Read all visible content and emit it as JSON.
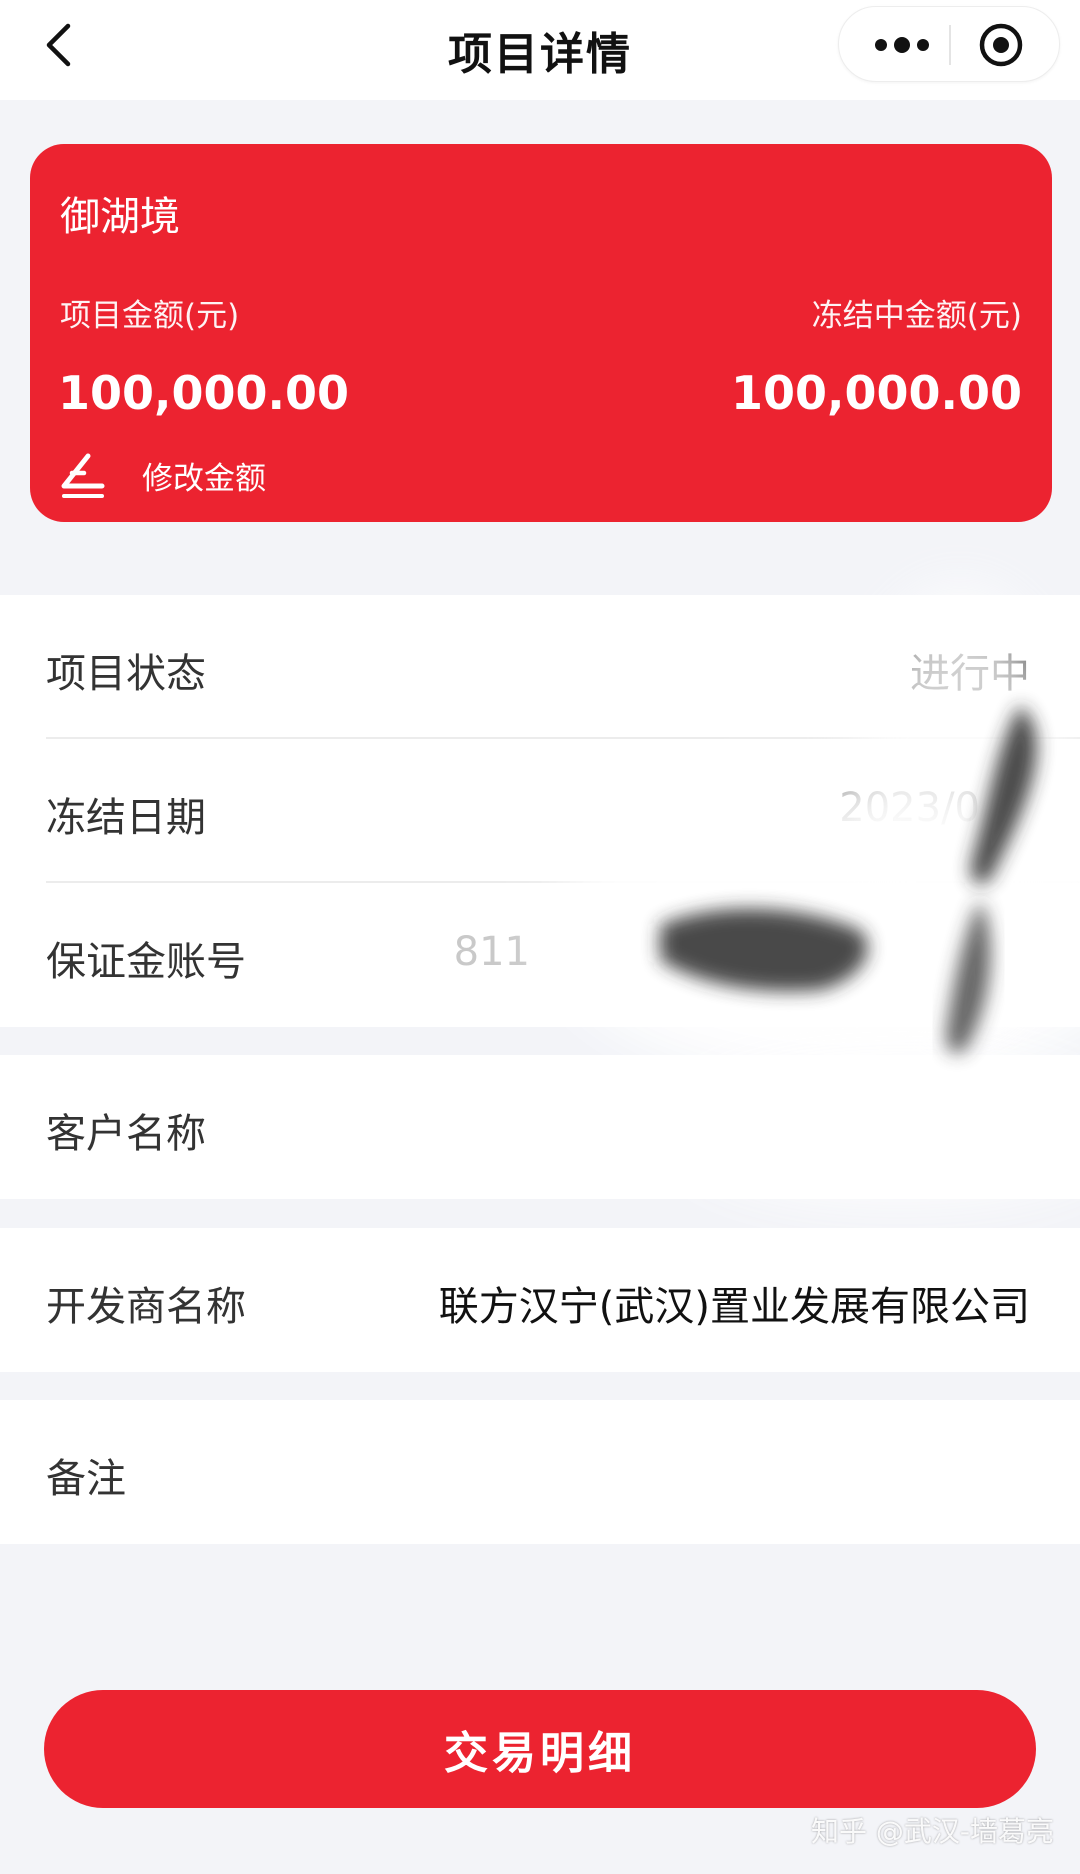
{
  "nav": {
    "title": "项目详情",
    "back_icon": "chevron-left-icon",
    "more_icon": "more-dots-icon",
    "close_icon": "record-circle-icon"
  },
  "card": {
    "project_name": "御湖境",
    "project_amount_label": "项目金额(元)",
    "frozen_amount_label": "冻结中金额(元)",
    "project_amount": "100,000.00",
    "frozen_amount": "100,000.00",
    "edit_label": "修改金额",
    "edit_icon": "edit-pen-icon",
    "color": "#ec2330"
  },
  "details": [
    {
      "label": "项目状态",
      "value": "进行中"
    },
    {
      "label": "冻结日期",
      "value": "2023/0"
    },
    {
      "label": "保证金账号",
      "value": "811"
    }
  ],
  "customer": {
    "label": "客户名称",
    "value": ""
  },
  "developer": {
    "label": "开发商名称",
    "value": "联方汉宁(武汉)置业发展有限公司"
  },
  "remark": {
    "label": "备注",
    "value": ""
  },
  "actions": {
    "transaction_detail": "交易明细"
  },
  "watermark": "知乎 @武汉-墙葛亮"
}
